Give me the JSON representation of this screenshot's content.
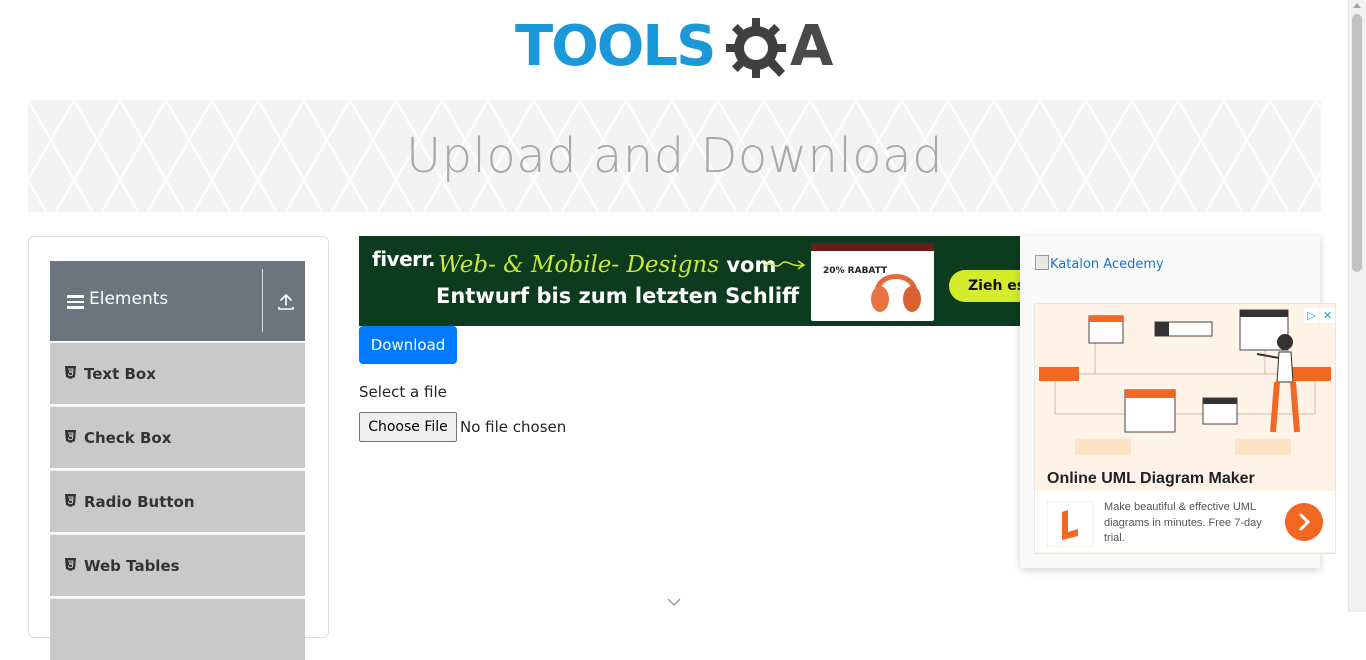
{
  "header": {
    "logo_text": "TOOLS",
    "logo_suffix": "A"
  },
  "banner": {
    "title": "Upload and Download"
  },
  "sidebar": {
    "group": {
      "title": "Elements",
      "icon": "hamburger-icon",
      "toggle_icon": "collapse-up-icon"
    },
    "items": [
      {
        "label": "Text Box",
        "icon": "html5-icon"
      },
      {
        "label": "Check Box",
        "icon": "html5-icon"
      },
      {
        "label": "Radio Button",
        "icon": "html5-icon"
      },
      {
        "label": "Web Tables",
        "icon": "html5-icon"
      },
      {
        "label": "",
        "icon": "html5-icon"
      }
    ]
  },
  "ad_top": {
    "brand": "fiverr.",
    "line1": "Web- & Mobile- Designs",
    "line1_suffix": "vom",
    "line2": "Entwurf bis zum letzten Schliff",
    "promo": "20% RABATT",
    "cta": "Zieh es d"
  },
  "main": {
    "download_label": "Download",
    "select_label": "Select a file",
    "choose_label": "Choose File",
    "file_status": "No file chosen"
  },
  "ad_right": {
    "broken_image_alt": "Katalon Acedemy",
    "badge_info": "▷",
    "badge_close": "✕",
    "title": "Online UML Diagram Maker",
    "description": "Make beautiful & effective UML diagrams in minutes. Free 7-day trial."
  },
  "colors": {
    "brand_blue": "#1a98d8",
    "group_header": "#6c757d",
    "menu_item": "#c9c9c9",
    "primary_button": "#007bff",
    "fiverr_bg": "#0c3b1e",
    "fiverr_accent": "#c8e83b",
    "uml_orange": "#f26722"
  }
}
